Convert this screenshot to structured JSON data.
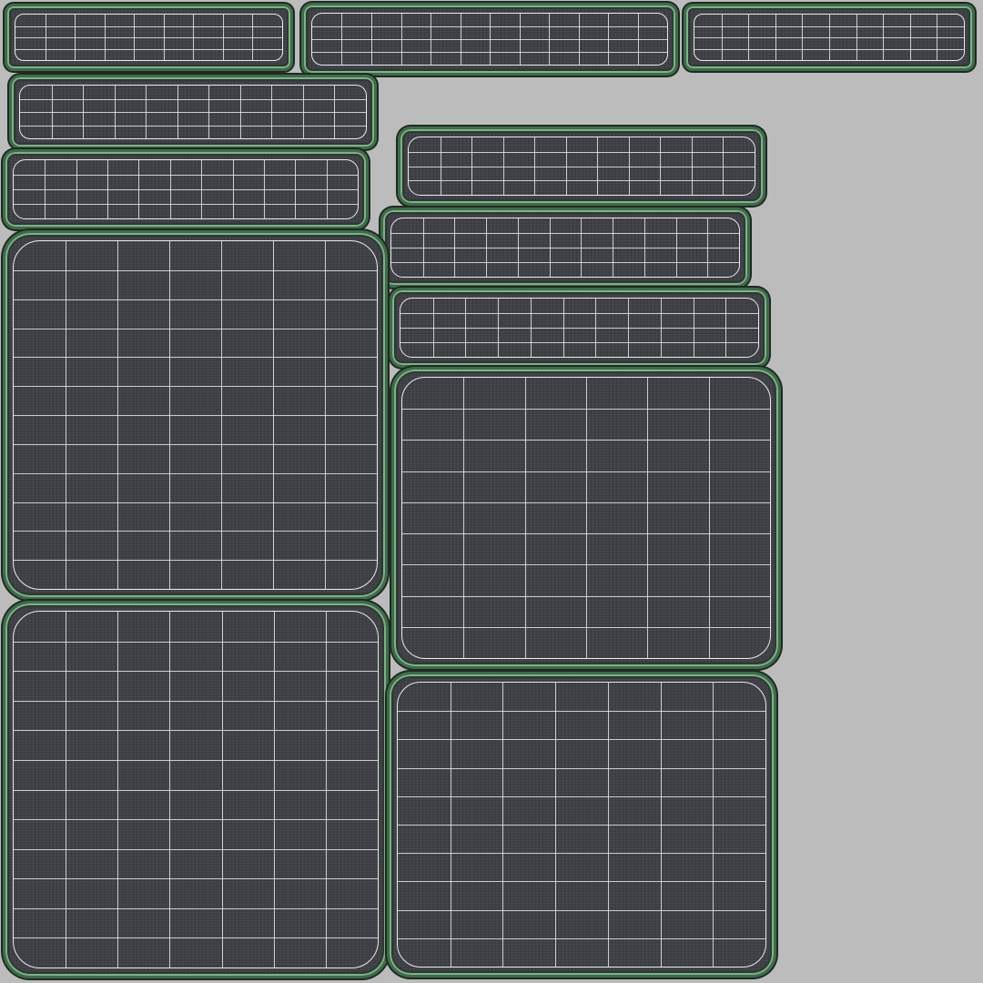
{
  "texture_sheet": {
    "background_color": "#bcbcbc",
    "fabric_color": "#3f4147",
    "seam_color": "#3f6b4a",
    "wire_color": "#ebebeb",
    "islands": [
      {
        "name": "top-strip-left",
        "cols": 9,
        "rows": 4
      },
      {
        "name": "top-strip-middle",
        "cols": 12,
        "rows": 4
      },
      {
        "name": "top-strip-right",
        "cols": 10,
        "rows": 4
      },
      {
        "name": "left-strip-upper",
        "cols": 11,
        "rows": 4
      },
      {
        "name": "left-strip-lower",
        "cols": 11,
        "rows": 4
      },
      {
        "name": "right-strip-upper",
        "cols": 11,
        "rows": 4
      },
      {
        "name": "right-strip-middle",
        "cols": 11,
        "rows": 4
      },
      {
        "name": "right-strip-lower",
        "cols": 11,
        "rows": 4
      },
      {
        "name": "left-square-upper",
        "cols": 7,
        "rows": 12
      },
      {
        "name": "right-square-upper",
        "cols": 6,
        "rows": 9
      },
      {
        "name": "left-square-lower",
        "cols": 7,
        "rows": 12
      },
      {
        "name": "right-square-lower",
        "cols": 7,
        "rows": 10
      }
    ]
  }
}
